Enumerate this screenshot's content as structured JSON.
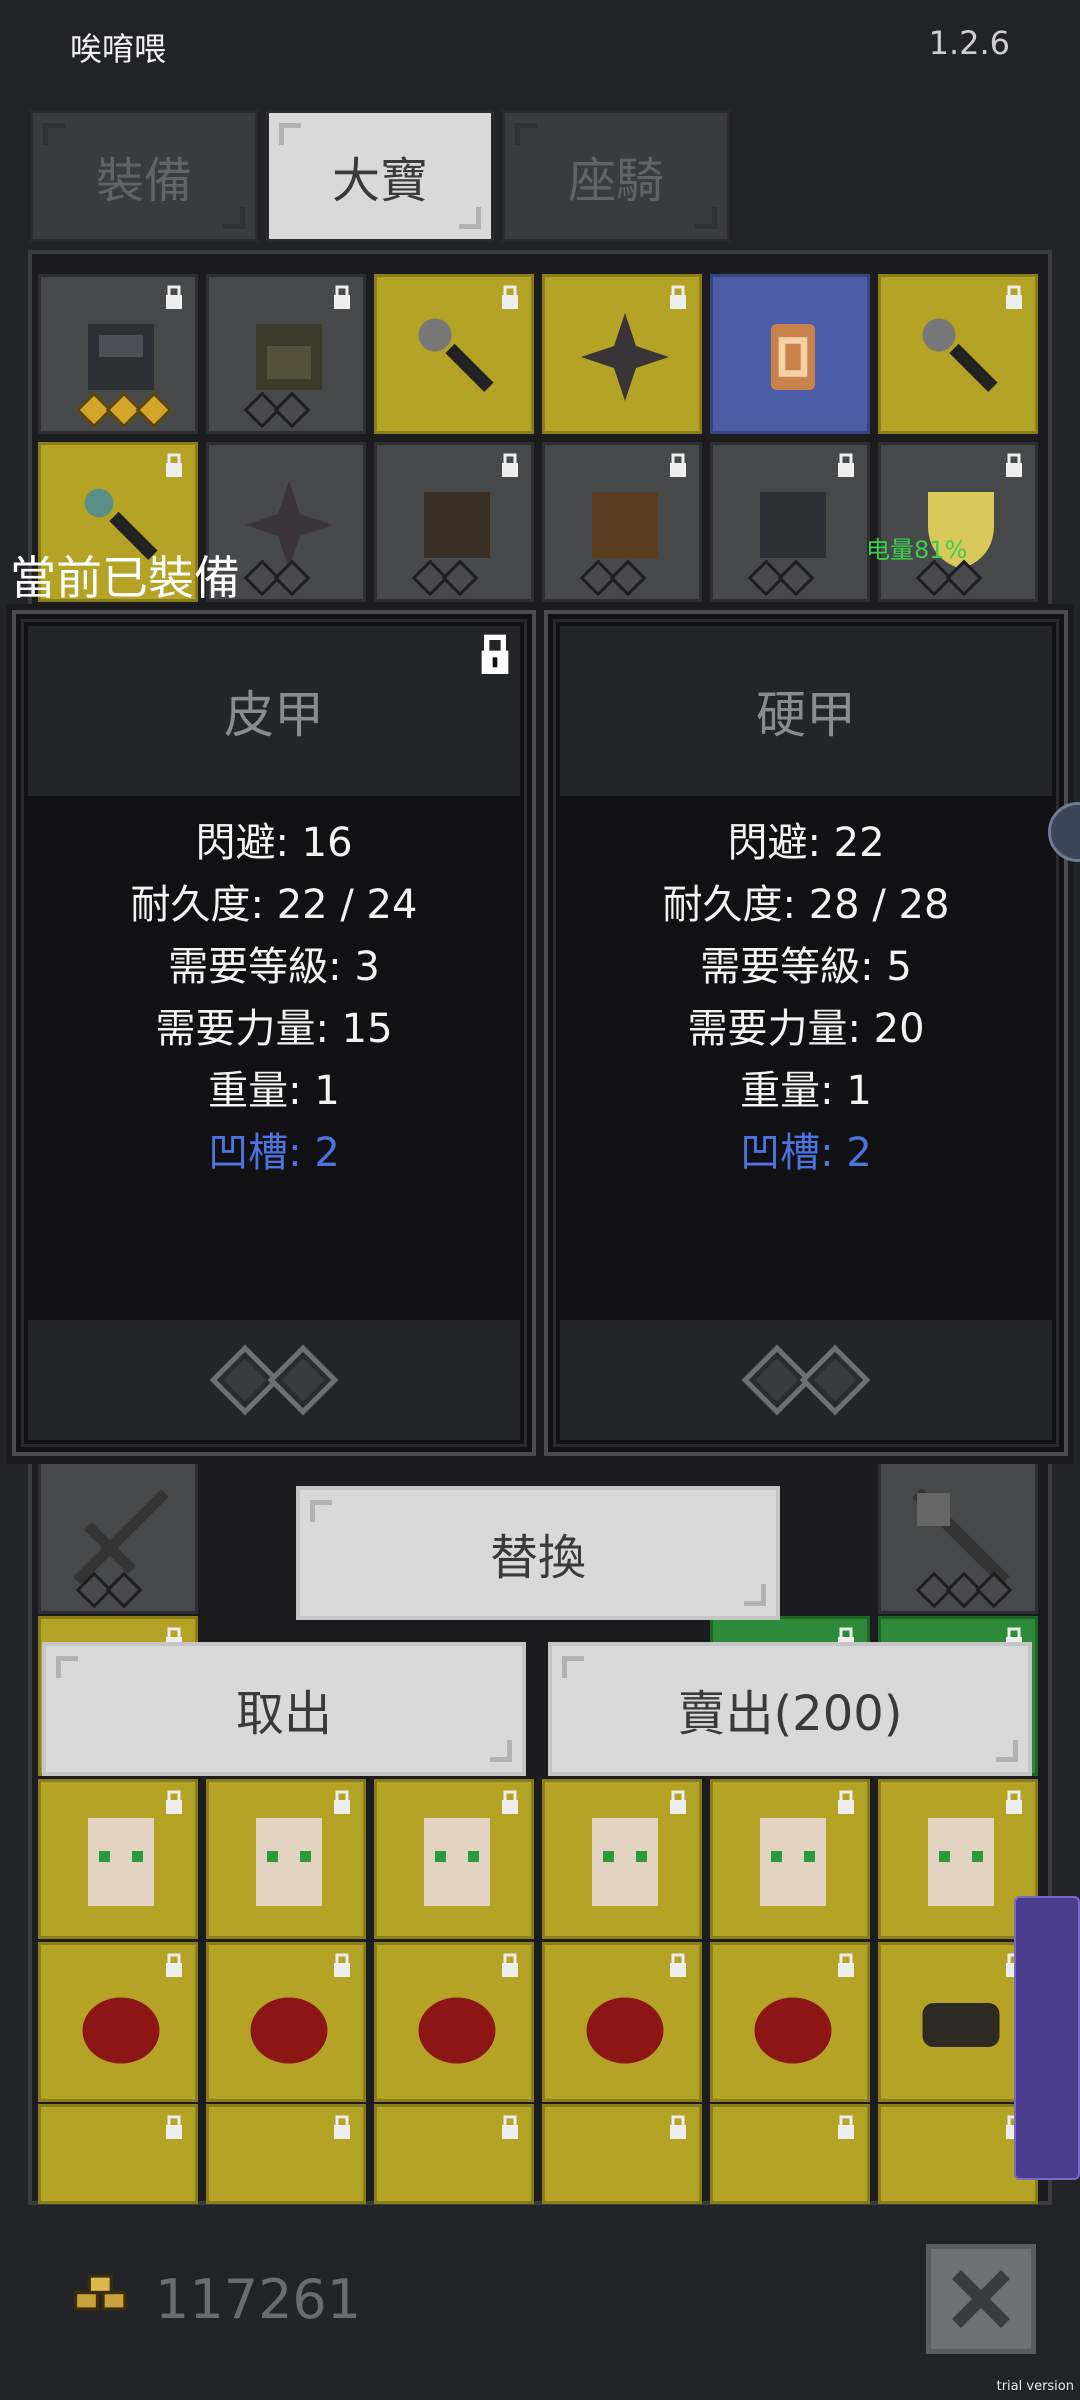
{
  "header": {
    "title": "唉唷喂",
    "version": "1.2.6"
  },
  "tabs": [
    {
      "label": "裝備",
      "active": false
    },
    {
      "label": "大寶",
      "active": true
    },
    {
      "label": "座騎",
      "active": false
    }
  ],
  "status": {
    "battery": "电量81%"
  },
  "compare": {
    "section_label": "當前已裝備",
    "equipped": {
      "name": "皮甲",
      "locked": true,
      "stats": [
        "閃避: 16",
        "耐久度: 22 / 24",
        "需要等級: 3",
        "需要力量: 15",
        "重量: 1"
      ],
      "sockets": "凹槽: 2"
    },
    "candidate": {
      "name": "硬甲",
      "stats": [
        "閃避: 22",
        "耐久度: 28 / 28",
        "需要等級: 5",
        "需要力量: 20",
        "重量: 1"
      ],
      "sockets": "凹槽: 2"
    }
  },
  "actions": {
    "replace": "替換",
    "take_out": "取出",
    "sell": "賣出(200)"
  },
  "footer": {
    "gold": "117261",
    "watermark": "trial version"
  },
  "colors": {
    "accent_blue": "#4d73e0",
    "tab_active": "#d9d9d9",
    "slot_yellow": "#b4a325",
    "slot_blue": "#4a5da6",
    "slot_green": "#2c8a38"
  }
}
